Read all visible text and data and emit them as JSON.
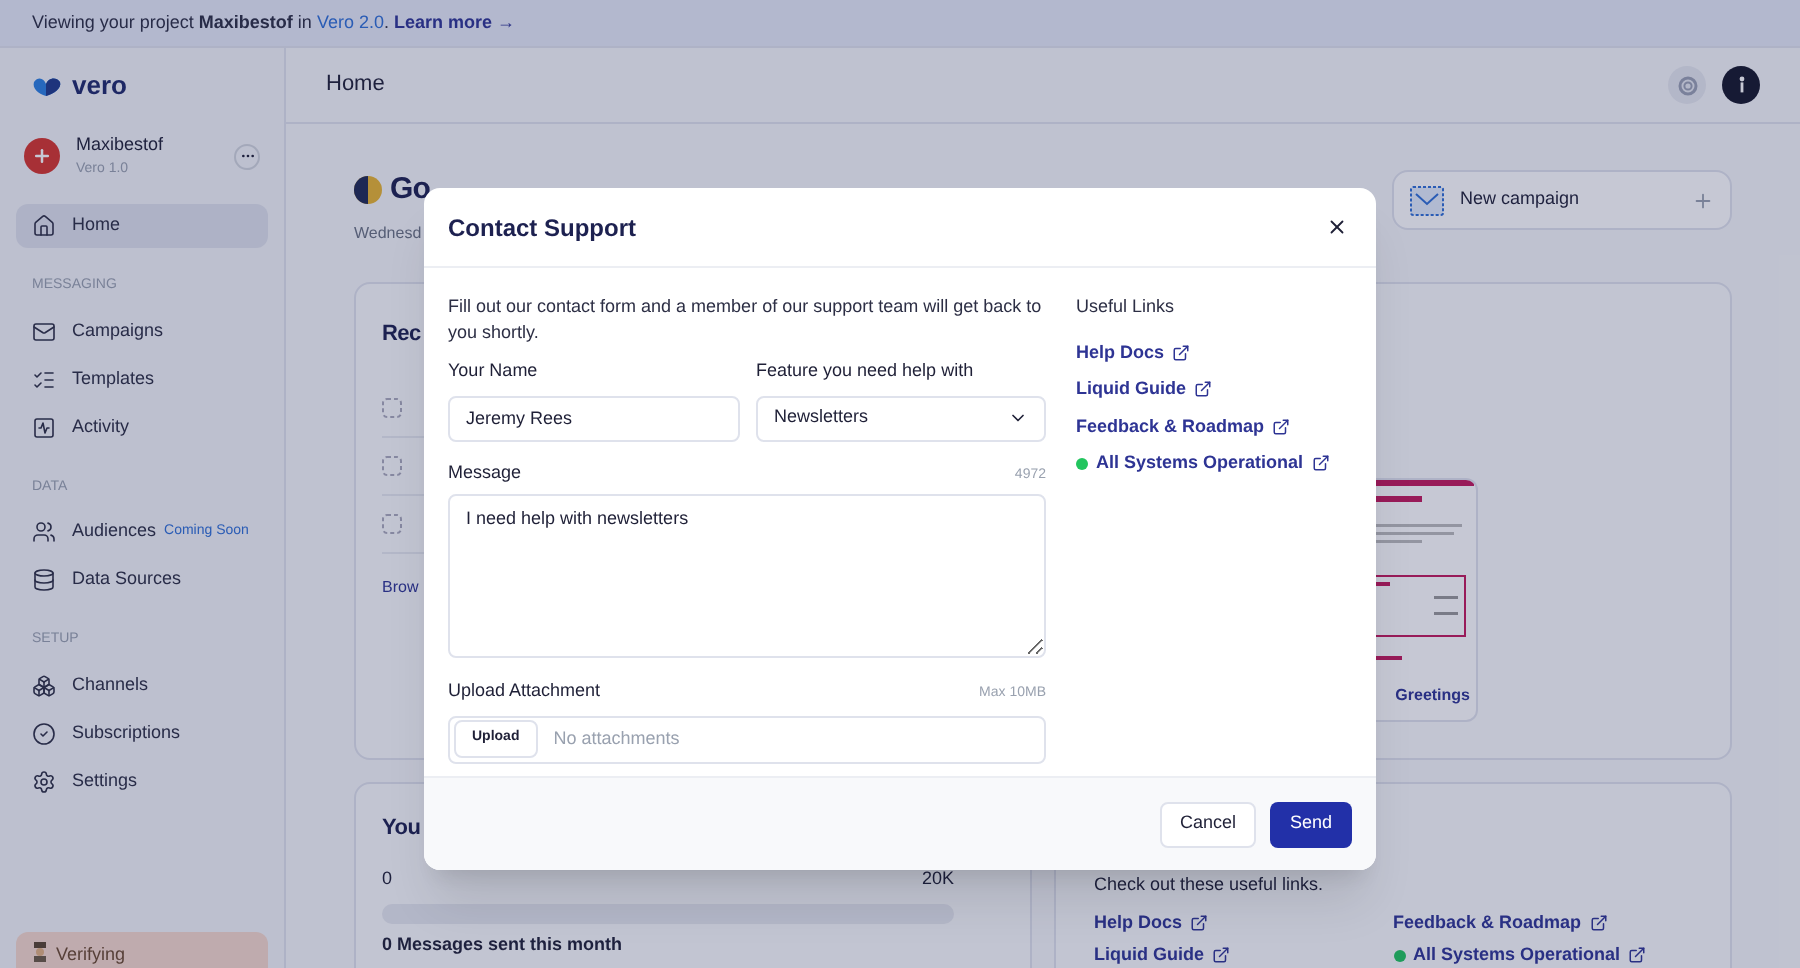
{
  "banner": {
    "text": "Viewing your project **Maxibestof** in",
    "version_link": "Vero 2.0",
    "after_link": ".",
    "link": "Learn more →"
  },
  "sidebar": {
    "logo": "vero",
    "workspace": {
      "name": "Maxibestof",
      "version": "Vero 1.0"
    },
    "items": [
      {
        "kind": "item",
        "label": "Home",
        "selected": true
      },
      {
        "kind": "section",
        "label": "MESSAGING"
      },
      {
        "kind": "item",
        "label": "Campaigns",
        "selected": false
      },
      {
        "kind": "item",
        "label": "Templates",
        "selected": false
      },
      {
        "kind": "item",
        "label": "Activity",
        "selected": false
      },
      {
        "kind": "section",
        "label": "DATA"
      },
      {
        "kind": "item",
        "label": "Audiences",
        "selected": false,
        "badge": "Coming Soon"
      },
      {
        "kind": "item",
        "label": "Data Sources",
        "selected": false
      },
      {
        "kind": "section",
        "label": "SETUP"
      },
      {
        "kind": "item",
        "label": "Channels",
        "selected": false
      },
      {
        "kind": "item",
        "label": "Subscriptions",
        "selected": false
      },
      {
        "kind": "item",
        "label": "Settings",
        "selected": false
      }
    ],
    "footer": "Verifying"
  },
  "header": {
    "title": "Home"
  },
  "greeting": {
    "title": "Go",
    "date": "Wednesd"
  },
  "new_campaign": {
    "label": "New campaign"
  },
  "recent_card": {
    "title": "Rec",
    "browse_link": "Brow",
    "template_name": "Greetings"
  },
  "usage_card": {
    "title": "You",
    "min": "0",
    "max": "20K",
    "level": 0,
    "caption": "0 Messages sent this month"
  },
  "links_card": {
    "text": "Check out these useful links.",
    "links": [
      {
        "label": "Help Docs"
      },
      {
        "label": "Feedback & Roadmap"
      },
      {
        "label": "Liquid Guide"
      },
      {
        "label": "All Systems Operational",
        "color": "#209d5b"
      }
    ]
  },
  "modal": {
    "title": "Contact Support",
    "intro": "Fill out our contact form and a member of our support team will get back to you shortly.",
    "name_label": "Your Name",
    "name_value": "Jeremy Rees",
    "feature_label": "Feature you need help with",
    "feature_value": "Newsletters",
    "message_label": "Message",
    "message_count": "4972",
    "message_value": "I need help with newsletters",
    "upload_label": "Upload Attachment",
    "upload_limit": "Max 10MB",
    "upload_button": "Upload",
    "upload_placeholder": "No attachments",
    "links_title": "Useful Links",
    "links": [
      {
        "label": "Help Docs"
      },
      {
        "label": "Liquid Guide"
      },
      {
        "label": "Feedback & Roadmap"
      },
      {
        "label": "All Systems Operational",
        "color": "#22c55e"
      }
    ],
    "cancel": "Cancel",
    "send": "Send"
  }
}
